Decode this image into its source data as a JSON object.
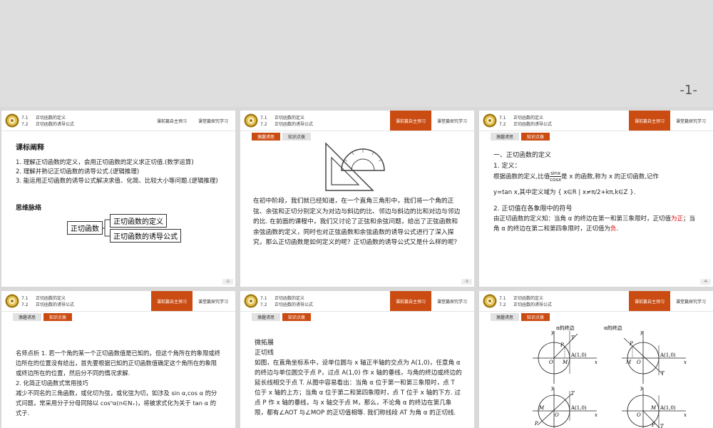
{
  "page_number": "-1-",
  "header": {
    "line1_no": "7.1",
    "line1_title": "正切函数的定义",
    "line2_no": "7.2",
    "line2_title": "正切函数的诱导公式",
    "tab_preview": "课前篇自主预习",
    "tab_explore": "课堂篇探究学习"
  },
  "subtabs": {
    "scenario": "激趣诱思",
    "knowledge": "知识点拨"
  },
  "slide1": {
    "heading": "课标阐释",
    "items": [
      "1. 理解正切函数的定义，会用正切函数的定义求正切值.(数学运算)",
      "2. 理解并熟记正切函数的诱导公式.(逻辑推理)",
      "3. 能运用正切函数的诱导公式解决求值、化简、比较大小等问题.(逻辑推理)"
    ],
    "mind_map_title": "思维脉络",
    "map_root": "正切函数",
    "map_branch1": "正切函数的定义",
    "map_branch2": "正切函数的诱导公式",
    "page": "-2-"
  },
  "slide2": {
    "text": "在初中阶段，我们就已经知道，在一个直角三角形中，我们将一个角的正弦、余弦和正切分别定义为对边与斜边的比、邻边与斜边的比和对边与邻边的比. 在前面的课程中，我们又讨论了正弦和余弦问题，给出了正弦函数和余弦函数的定义，同时也对正弦函数和余弦函数的诱导公式进行了深入探究，那么正切函数是如何定义的呢？正切函数的诱导公式又是什么样的呢？",
    "page": "-3-"
  },
  "slide3": {
    "section": "一、正切函数的定义",
    "def_label": "1. 定义：",
    "def_text1": "根据函数的定义,比值",
    "frac_num": "sinx",
    "frac_den": "cosx",
    "def_text2": "是 x 的函数,称为 x 的正切函数,记作",
    "def_text3": "y=tan x,其中定义域为",
    "domain_set": "{ x∈R | x≠π/2+kπ,k∈Z }.",
    "sign_title": "2. 正切值在各象限中的符号",
    "sign_text1": "由正切函数的定义知：当角 α 的终边在第一和第三象限时，正切值",
    "sign_pos": "为正",
    "sign_text2": "；当角 α 的终边在第二和第四象限时，正切值为",
    "sign_neg": "负",
    "sign_end": ".",
    "page": "-4-"
  },
  "slide4": {
    "text1": "名师点析 1. 若一个角的某一个正切函数值是已知的，但这个角所在的象限或终边所在的位置没有给出，首先要根据已知的正切函数值确定这个角所在的象限或终边所在的位置，然后分不同的情况求解.",
    "text2": "2. 化简正切函数式常用技巧",
    "text3": "减少不同名的三角函数，或化切为弦，或化弦为切，如涉及 sin α,cos α 的分式问题，常采用分子分母同除以 cosⁿα(n∈N₊)，将被求式化为关于 tan α 的式子."
  },
  "slide5": {
    "title": "微拓展",
    "subtitle": "正切线",
    "text": "如图，在直角坐标系中，设单位圆与 x 轴正半轴的交点为 A(1,0)，任意角 α 的终边与单位圆交于点 P，过点 A(1,0) 作 x 轴的垂线，与角的终边或终边的延长线相交于点 T. 从图中容易看出：当角 α 位于第一和第三象限时，点 T 位于 x 轴的上方；当角 α 位于第二和第四象限时，点 T 位于 x 轴的下方. 过点 P 作 x 轴的垂线，与 x 轴交于点 M，那么，不论角 α 的终边在第几象限，都有∠AOT 与∠MOP 的正切值相等. 我们称线段 AT 为角 α 的正切线."
  },
  "slide6": {
    "terminal1": "α的终边",
    "terminal2": "α的终边",
    "labels": {
      "y": "y",
      "x": "x",
      "O": "O",
      "P": "P",
      "M": "M",
      "T": "T",
      "A": "A(1,0)"
    }
  }
}
